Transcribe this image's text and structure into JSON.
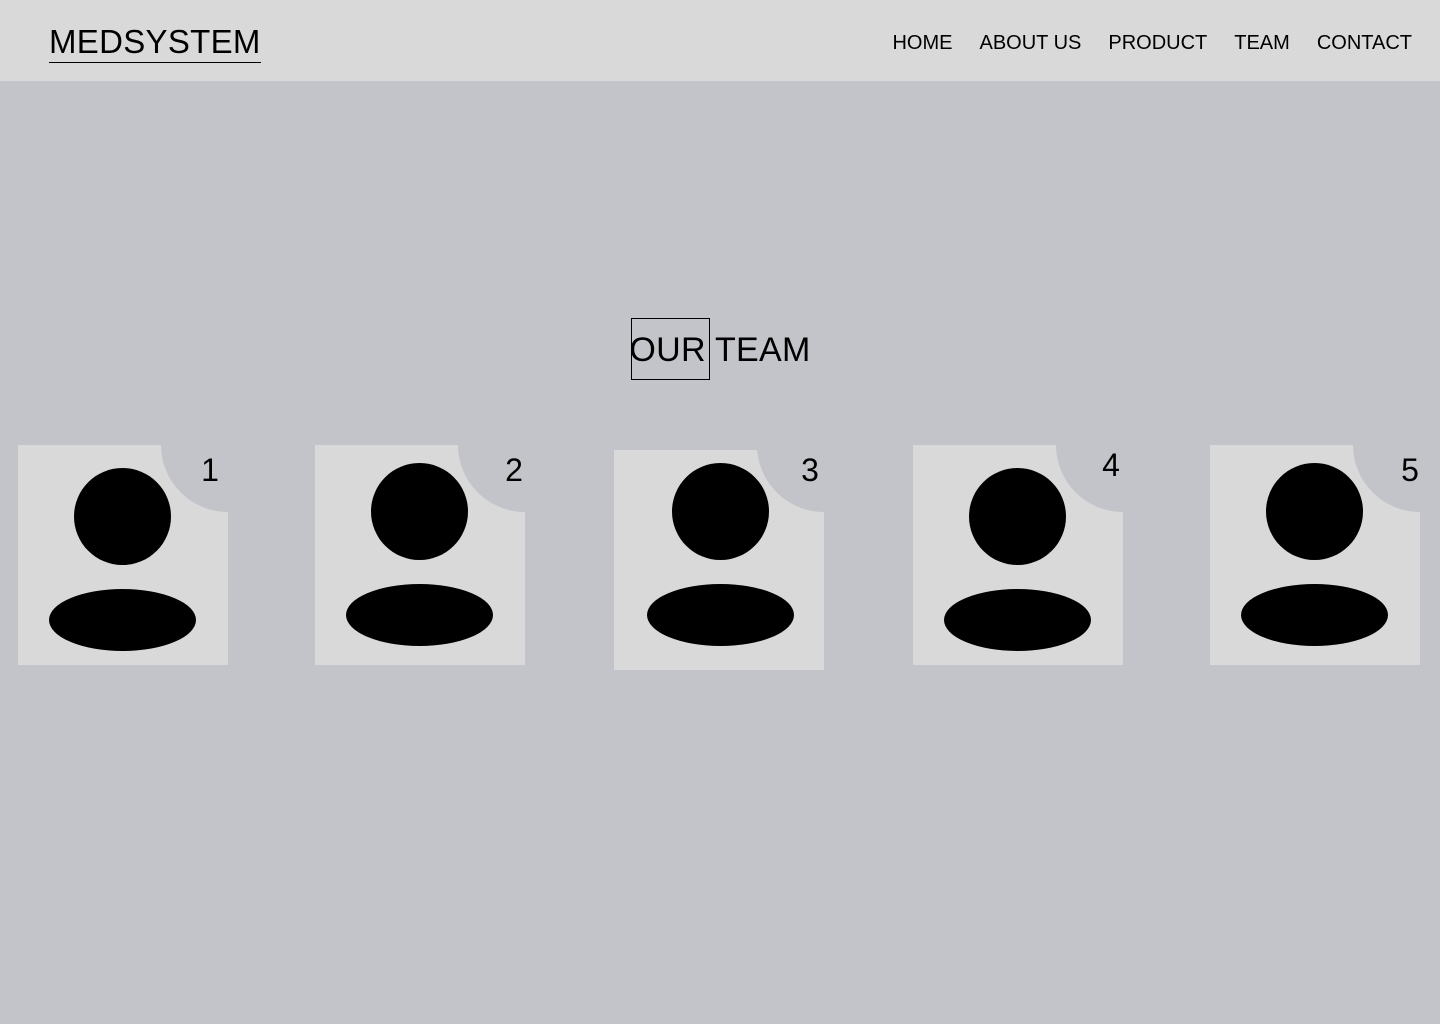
{
  "header": {
    "logo": "MEDSYSTEM",
    "nav": [
      "HOME",
      "ABOUT US",
      "PRODUCT",
      "TEAM",
      "CONTACT"
    ]
  },
  "section": {
    "title": "OUR TEAM"
  },
  "team": {
    "members": [
      {
        "number": "1"
      },
      {
        "number": "2"
      },
      {
        "number": "3"
      },
      {
        "number": "4"
      },
      {
        "number": "5"
      }
    ]
  },
  "colors": {
    "background": "#c3c4c9",
    "header": "#d9d9d9",
    "card": "#d9d9d9",
    "text": "#000000"
  }
}
